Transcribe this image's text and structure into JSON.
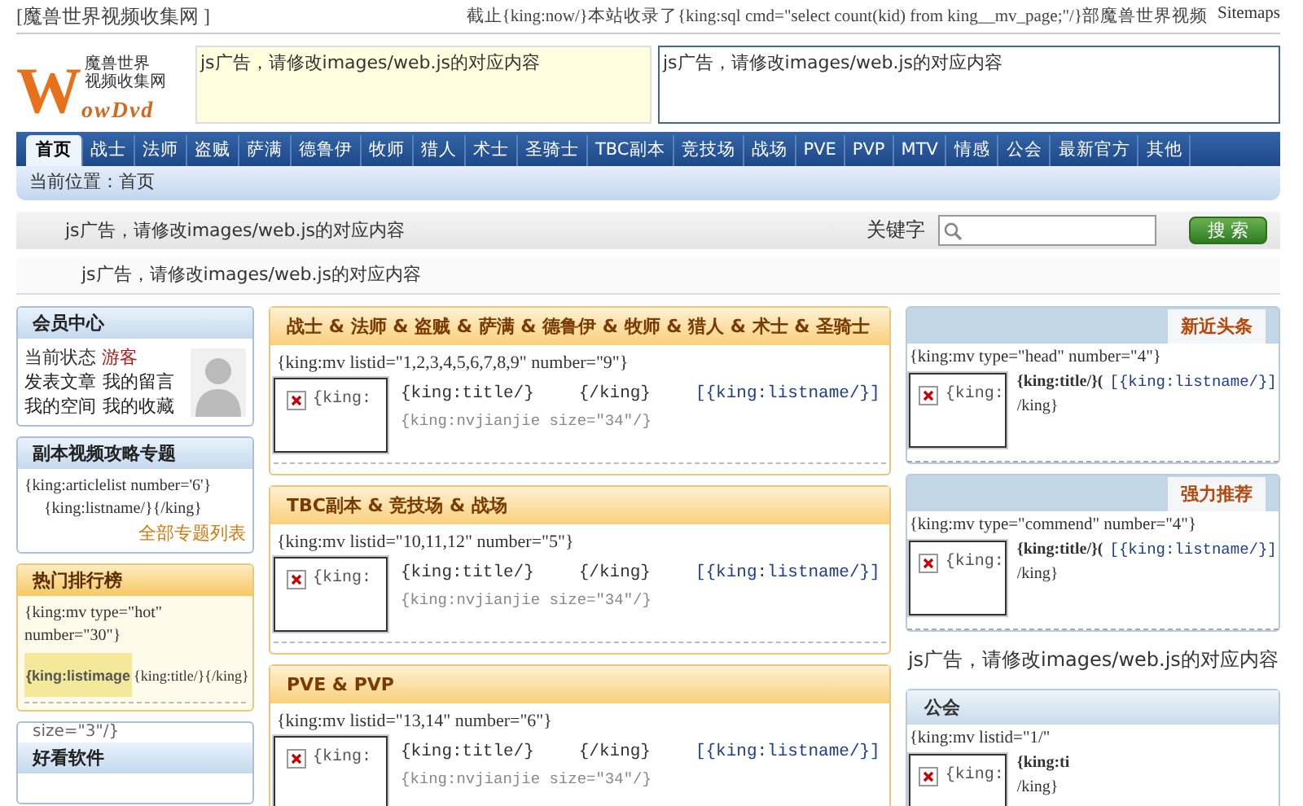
{
  "top_bar": {
    "site_name": "[魔兽世界视频收集网 ]",
    "stats": "截止{king:now/}本站收录了{king:sql cmd=\"select count(kid) from king__mv_page;\"/}部魔兽世界视频",
    "sitemap_link": "Sitemaps"
  },
  "logo": {
    "letter": "W",
    "name_line_1": "魔兽世界",
    "name_line_2": "视频收集网",
    "wordmark": "owDvd"
  },
  "header_ads": [
    "js广告，请修改images/web.js的对应内容",
    "js广告，请修改images/web.js的对应内容"
  ],
  "nav": [
    {
      "label": "首页",
      "selected": true
    },
    {
      "label": "战士",
      "selected": false
    },
    {
      "label": "法师",
      "selected": false
    },
    {
      "label": "盗贼",
      "selected": false
    },
    {
      "label": "萨满",
      "selected": false
    },
    {
      "label": "德鲁伊",
      "selected": false
    },
    {
      "label": "牧师",
      "selected": false
    },
    {
      "label": "猎人",
      "selected": false
    },
    {
      "label": "术士",
      "selected": false
    },
    {
      "label": "圣骑士",
      "selected": false
    },
    {
      "label": "TBC副本",
      "selected": false
    },
    {
      "label": "竞技场",
      "selected": false
    },
    {
      "label": "战场",
      "selected": false
    },
    {
      "label": "PVE",
      "selected": false
    },
    {
      "label": "PVP",
      "selected": false
    },
    {
      "label": "MTV",
      "selected": false
    },
    {
      "label": "情感",
      "selected": false
    },
    {
      "label": "公会",
      "selected": false
    },
    {
      "label": "最新官方",
      "selected": false
    },
    {
      "label": "其他",
      "selected": false
    }
  ],
  "breadcrumb": "当前位置：首页",
  "search_bar": {
    "ad": "js广告，请修改images/web.js的对应内容",
    "label": "关键字",
    "button": "搜 索"
  },
  "ad_strip": "js广告，请修改images/web.js的对应内容",
  "left_panels": [
    {
      "kind": "member",
      "title": "会员中心",
      "status_label": "当前状态",
      "status_value": "游客",
      "links": [
        "发表文章",
        "我的留言",
        "我的空间",
        "我的收藏"
      ]
    },
    {
      "kind": "topics",
      "title": "副本视频攻略专题",
      "template_open": "{king:articlelist number='6'}",
      "template_item": "{king:listname/}{/king}",
      "more_link": "全部专题列表"
    },
    {
      "kind": "ranking",
      "title": "热门排行榜",
      "template_open": "{king:mv type=\"hot\" number=\"30\"}",
      "image_text": "{king:listimage",
      "item_text": "{king:title/}{/king}"
    },
    {
      "kind": "software",
      "title": "好看软件",
      "overflow_text": "size=\"3\"/}"
    }
  ],
  "sections": [
    {
      "title": "战士 & 法师 & 盗贼 & 萨满 & 德鲁伊 & 牧师 & 猎人 & 术士 & 圣骑士",
      "template_open": "{king:mv listid=\"1,2,3,4,5,6,7,8,9\" number=\"9\"}",
      "item": {
        "image_text": "{king:",
        "title": "{king:title/}",
        "close": "{/king}",
        "category": "[{king:listname/}]",
        "summary": "{king:nvjianjie size=\"34\"/}"
      }
    },
    {
      "title": "TBC副本 & 竞技场 & 战场",
      "template_open": "{king:mv listid=\"10,11,12\" number=\"5\"}",
      "item": {
        "image_text": "{king:",
        "title": "{king:title/}",
        "close": "{/king}",
        "category": "[{king:listname/}]",
        "summary": "{king:nvjianjie size=\"34\"/}"
      }
    },
    {
      "title": "PVE & PVP",
      "template_open": "{king:mv listid=\"13,14\" number=\"6\"}",
      "item": {
        "image_text": "{king:",
        "title": "{king:title/}",
        "close": "{/king}",
        "category": "[{king:listname/}]",
        "summary": "{king:nvjianjie size=\"34\"/}"
      }
    }
  ],
  "right_panels": [
    {
      "kind": "tabbed",
      "title": "新近头条",
      "template_open": "{king:mv type=\"head\" number=\"4\"}",
      "item": {
        "image_text": "{king:",
        "title": "{king:title/}(",
        "category": "[{king:listname/}]",
        "close": "/king}"
      }
    },
    {
      "kind": "tabbed",
      "title": "强力推荐",
      "template_open": "{king:mv type=\"commend\" number=\"4\"}",
      "item": {
        "image_text": "{king:",
        "title": "{king:title/}(",
        "category": "[{king:listname/}]",
        "close": "/king}"
      }
    },
    {
      "kind": "ad",
      "text": "js广告，请修改images/web.js的对应内容"
    },
    {
      "kind": "titled",
      "title": "公会",
      "template_open": "{king:mv listid=\"1/\"",
      "item": {
        "image_text": "{king:",
        "title": "{king:ti",
        "close": "/king}"
      }
    }
  ]
}
